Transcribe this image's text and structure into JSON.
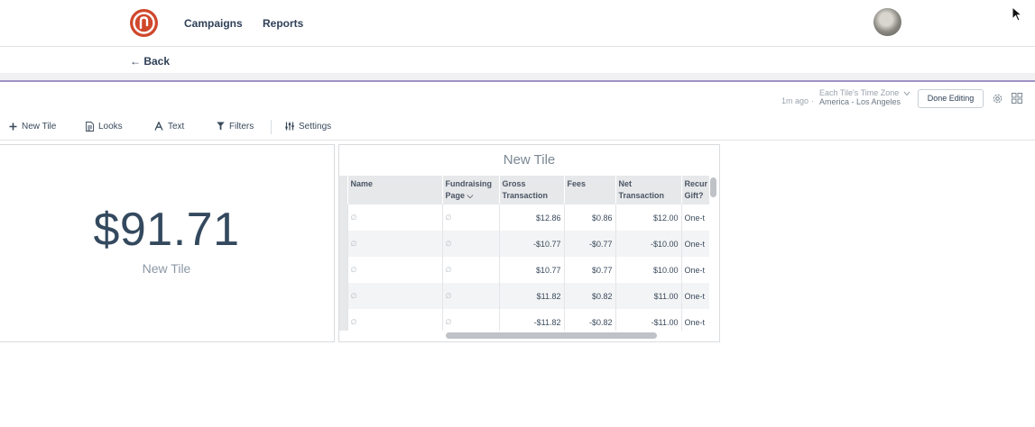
{
  "nav": {
    "links": [
      "Campaigns",
      "Reports"
    ]
  },
  "back": {
    "label": "← Back"
  },
  "meta": {
    "updated_ago": "1m ago",
    "separator": "·",
    "timezone_label": "Each Tile's Time Zone",
    "timezone_value": "America - Los Angeles",
    "done_editing": "Done Editing"
  },
  "toolbar": {
    "new_tile": "New Tile",
    "looks": "Looks",
    "text": "Text",
    "filters": "Filters",
    "settings": "Settings"
  },
  "tile_single": {
    "value": "$91.71",
    "caption": "New Tile"
  },
  "tile_table": {
    "title": "New Tile",
    "headers": [
      "Name",
      "Fundraising Page",
      "Gross Transaction",
      "Fees",
      "Net Transaction",
      "Recurring Gift?"
    ],
    "header_lines": [
      [
        "Name",
        ""
      ],
      [
        "Fundraising",
        "Page ⌵"
      ],
      [
        "Gross",
        "Transaction"
      ],
      [
        "Fees",
        ""
      ],
      [
        "Net",
        "Transaction"
      ],
      [
        "Recur",
        "Gift?"
      ]
    ],
    "null_glyph": "∅",
    "rows": [
      [
        "$12.86",
        "$0.86",
        "$12.00",
        "One-t"
      ],
      [
        "-$10.77",
        "-$0.77",
        "-$10.00",
        "One-t"
      ],
      [
        "$10.77",
        "$0.77",
        "$10.00",
        "One-t"
      ],
      [
        "$11.82",
        "$0.82",
        "$11.00",
        "One-t"
      ],
      [
        "-$11.82",
        "-$0.82",
        "-$11.00",
        "One-t"
      ]
    ]
  },
  "colors": {
    "brand": "#d0482c",
    "accent_line": "#9f93c6",
    "text_dark": "#2f4058"
  },
  "icons": [
    "logo-icon",
    "avatar",
    "cursor-icon",
    "chevron-down-icon",
    "gear-icon",
    "grid-icon",
    "plus-icon",
    "document-icon",
    "text-icon",
    "filter-icon",
    "settings-sliders-icon"
  ]
}
